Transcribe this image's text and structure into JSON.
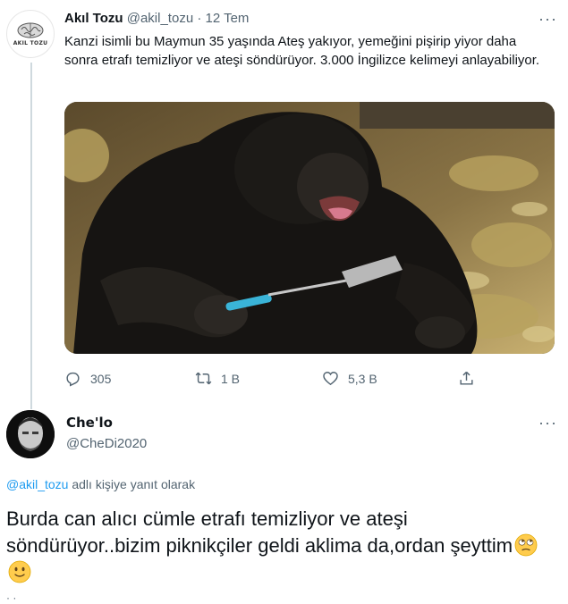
{
  "tweet": {
    "author_name": "Akıl Tozu",
    "author_handle": "@akil_tozu",
    "date": "· 12 Tem",
    "avatar_text": "AKIL TOZU",
    "text": "Kanzi isimli bu Maymun 35 yaşında Ateş yakıyor, yemeğini pişirip yiyor daha sonra etrafı temizliyor ve ateşi söndürüyor. 3.000 İngilizce kelimeyi anlayabiliyor.",
    "actions": {
      "replies": "305",
      "retweets": "1 B",
      "likes": "5,3 B"
    }
  },
  "reply": {
    "author_name": "Che'lo",
    "author_handle": "@CheDi2020",
    "reply_to_mention": "@akil_tozu",
    "reply_to_suffix": " adlı kişiye yanıt olarak",
    "text": "Burda can alıcı cümle etrafı temizliyor ve ateşi söndürüyor..bizim piknikçiler geldi aklima da,ordan şeyttim",
    "emojis": [
      "face-with-rolling-eyes",
      "slightly-smiling-face"
    ]
  },
  "icons": {
    "more": "more-horizontal-icon",
    "reply": "reply-icon",
    "retweet": "retweet-icon",
    "like": "heart-icon",
    "share": "share-icon"
  },
  "colors": {
    "text": "#0f1419",
    "secondary": "#536471",
    "link": "#1d9bf0",
    "thread_line": "#cfd9de"
  }
}
